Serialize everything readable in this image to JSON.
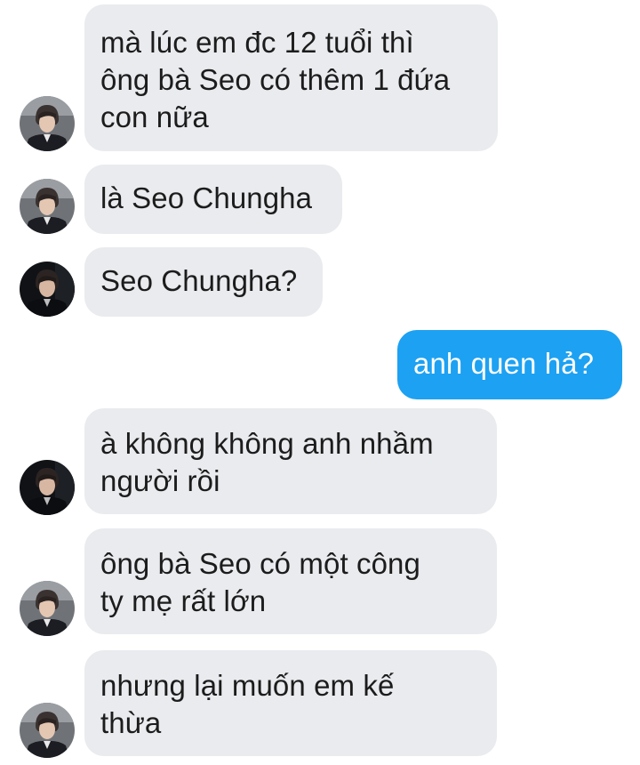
{
  "conversation": {
    "contact_avatar": "profile-photo-icon",
    "colors": {
      "incoming_bubble": "#e9ebee",
      "incoming_text": "#1c1c1c",
      "outgoing_bubble": "#1da1f2",
      "outgoing_text": "#ffffff"
    },
    "messages": [
      {
        "sender": "them",
        "text": "mà lúc em đc 12 tuổi thì\nông bà Seo có thêm 1 đứa\ncon nữa"
      },
      {
        "sender": "them",
        "text": "là Seo Chungha"
      },
      {
        "sender": "them",
        "text": "Seo Chungha?"
      },
      {
        "sender": "me",
        "text": "anh quen hả?"
      },
      {
        "sender": "them",
        "text": "à không không anh nhầm\nngười rồi"
      },
      {
        "sender": "them",
        "text": "ông bà Seo có một công\nty mẹ rất lớn"
      },
      {
        "sender": "them",
        "text": "nhưng lại muốn em kế\nthừa"
      }
    ]
  }
}
